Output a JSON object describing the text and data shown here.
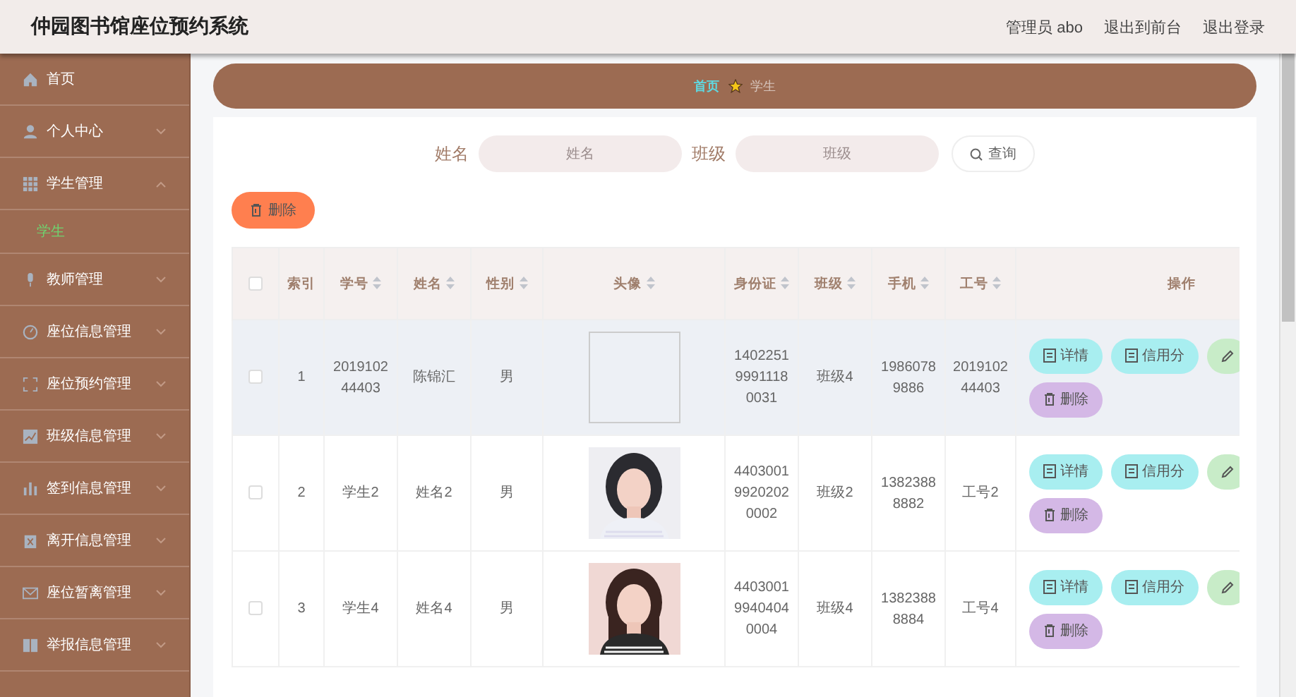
{
  "header": {
    "title": "仲园图书馆座位预约系统",
    "links": [
      "管理员 abo",
      "退出到前台",
      "退出登录"
    ]
  },
  "sidebar": {
    "items": [
      {
        "label": "首页"
      },
      {
        "label": "个人中心",
        "expanded": false
      },
      {
        "label": "学生管理",
        "expanded": true,
        "children": [
          {
            "label": "学生",
            "selected": true
          }
        ]
      },
      {
        "label": "教师管理",
        "expanded": false
      },
      {
        "label": "座位信息管理",
        "expanded": false
      },
      {
        "label": "座位预约管理",
        "expanded": false
      },
      {
        "label": "班级信息管理",
        "expanded": false
      },
      {
        "label": "签到信息管理",
        "expanded": false
      },
      {
        "label": "离开信息管理",
        "expanded": false
      },
      {
        "label": "座位暂离管理",
        "expanded": false
      },
      {
        "label": "举报信息管理",
        "expanded": false
      }
    ]
  },
  "breadcrumb": [
    "首页",
    "学生"
  ],
  "search": {
    "fields": [
      {
        "label": "姓名",
        "placeholder": "姓名"
      },
      {
        "label": "班级",
        "placeholder": "班级"
      }
    ],
    "button": "查询"
  },
  "delete_button": "删除",
  "table": {
    "select_all": {
      "checked": false
    },
    "columns": [
      {
        "label": "索引",
        "sortable": false
      },
      {
        "label": "学号",
        "sortable": true
      },
      {
        "label": "姓名",
        "sortable": true
      },
      {
        "label": "性别",
        "sortable": true
      },
      {
        "label": "头像",
        "sortable": true
      },
      {
        "label": "身份证",
        "sortable": true
      },
      {
        "label": "班级",
        "sortable": true
      },
      {
        "label": "手机",
        "sortable": true
      },
      {
        "label": "工号",
        "sortable": true
      },
      {
        "label": "操作",
        "sortable": false
      }
    ],
    "rows": [
      {
        "checked": false,
        "highlighted": true,
        "cells": [
          "1",
          "201910244403",
          "陈锦汇",
          "男"
        ],
        "avatar": {
          "kind": "broken"
        },
        "rest": [
          "140225199911180031",
          "班级4",
          "19860789886",
          "201910244403"
        ],
        "actions": [
          {
            "kind": "detail",
            "label": "详情"
          },
          {
            "kind": "credit",
            "label": "信用分"
          },
          {
            "kind": "edit"
          },
          {
            "kind": "delete",
            "label": "删除"
          }
        ]
      },
      {
        "checked": false,
        "highlighted": false,
        "cells": [
          "2",
          "学生2",
          "姓名2",
          "男"
        ],
        "rest": [
          "440300199202020002",
          "班级2",
          "13823888882",
          "工号2"
        ],
        "actions": [
          {
            "kind": "detail",
            "label": "详情"
          },
          {
            "kind": "credit",
            "label": "信用分"
          },
          {
            "kind": "edit"
          },
          {
            "kind": "delete",
            "label": "删除"
          }
        ]
      },
      {
        "checked": false,
        "highlighted": false,
        "cells": [
          "3",
          "学生4",
          "姓名4",
          "男"
        ],
        "rest": [
          "440300199404040004",
          "班级4",
          "13823888884",
          "工号4"
        ],
        "actions": [
          {
            "kind": "detail",
            "label": "详情"
          },
          {
            "kind": "credit",
            "label": "信用分"
          },
          {
            "kind": "edit"
          },
          {
            "kind": "delete",
            "label": "删除"
          }
        ]
      }
    ]
  }
}
